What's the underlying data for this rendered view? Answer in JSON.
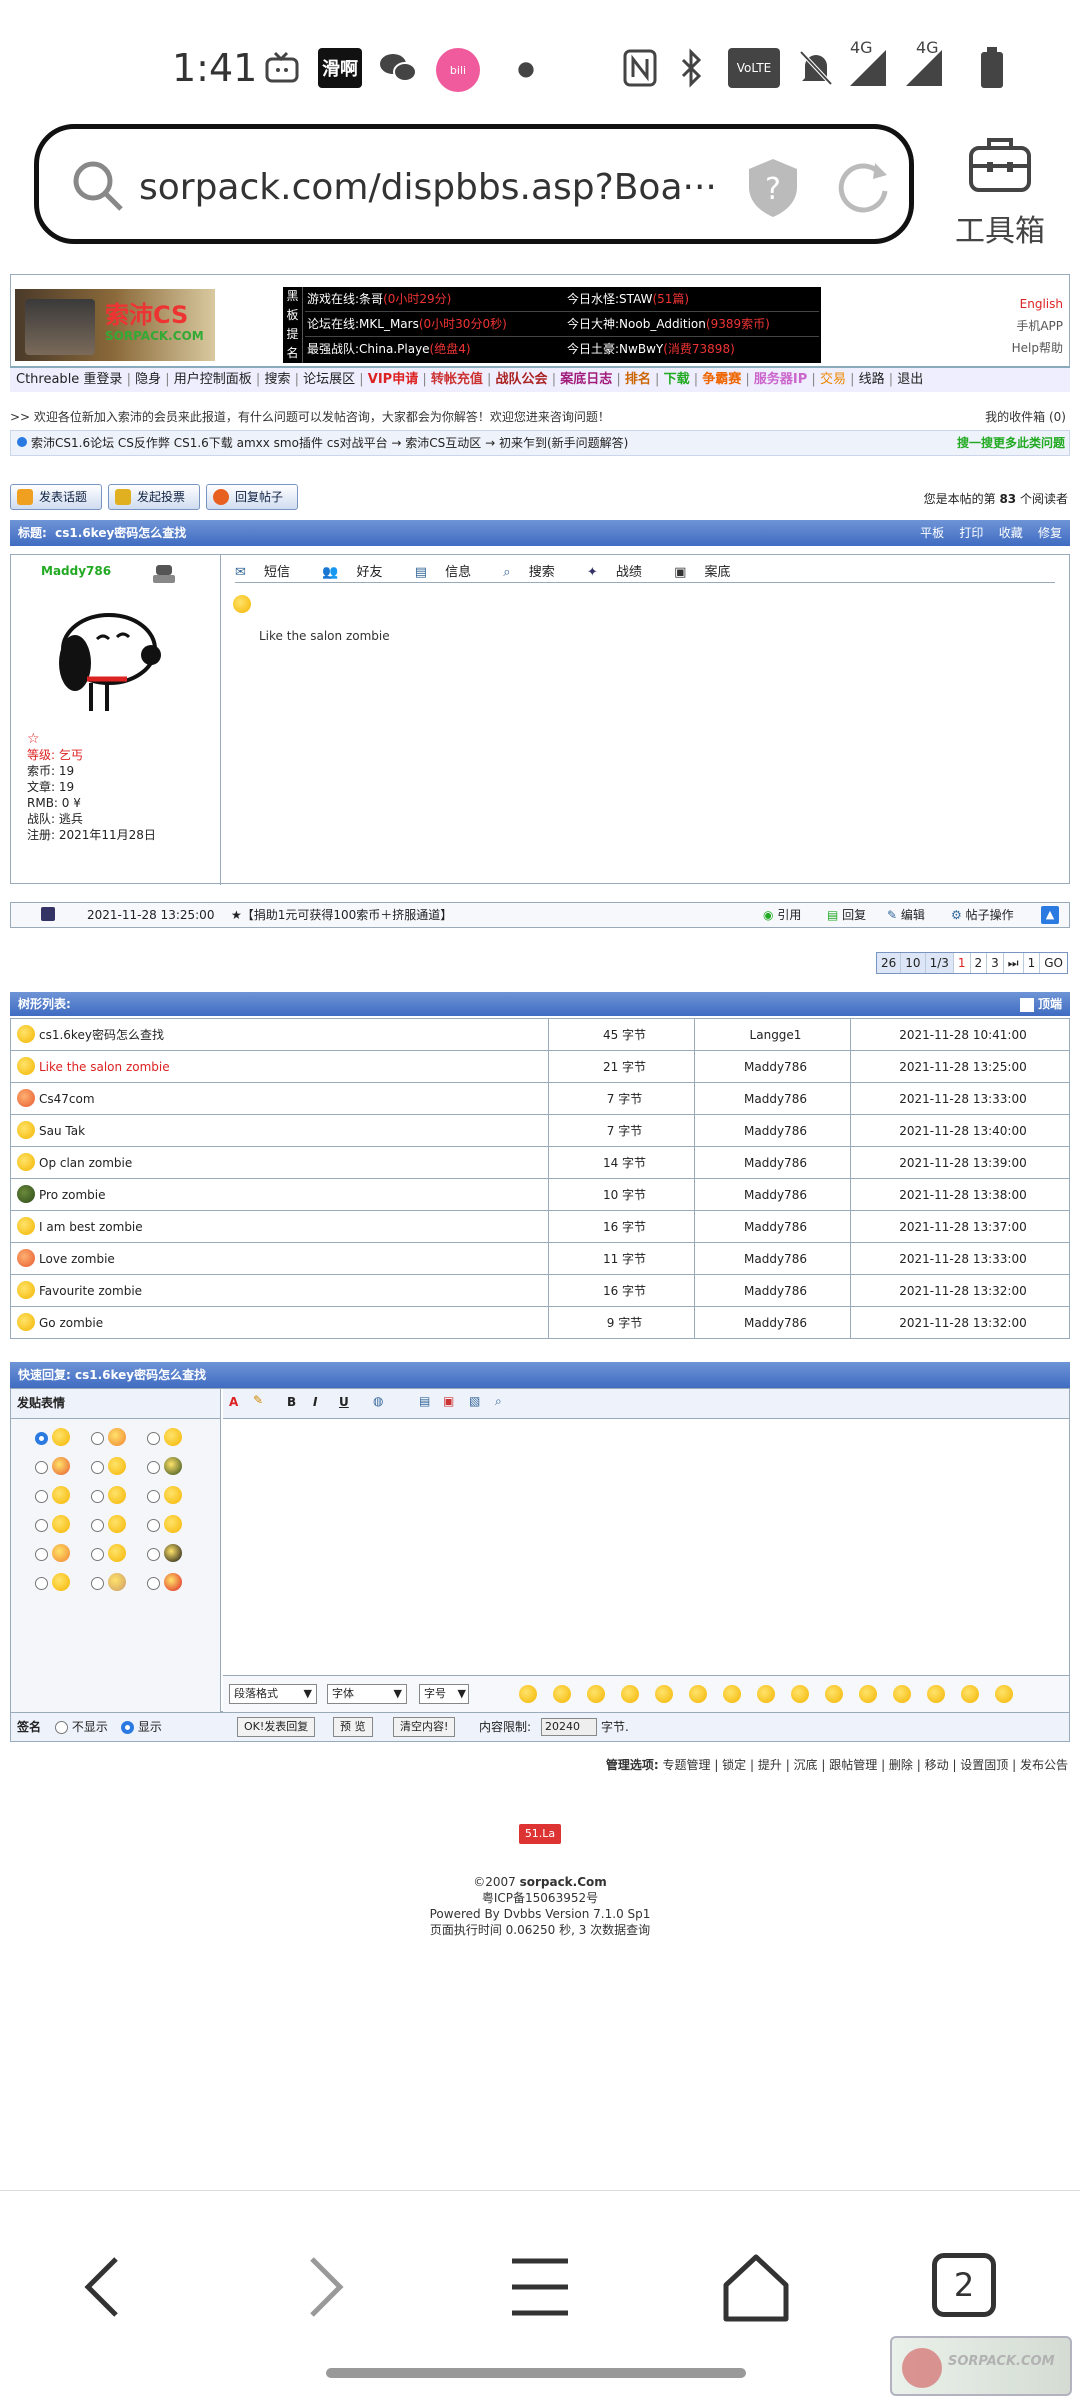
{
  "status_bar": {
    "time": "1:41",
    "notif_label": "滑啊",
    "signal1": "4G",
    "signal2": "4G"
  },
  "browser": {
    "url": "sorpack.com/dispbbs.asp?Boa···",
    "toolbox_label": "工具箱",
    "tab_count": "2"
  },
  "header": {
    "logo_text": "索沛CS",
    "logo_sub": "SORPACK.COM",
    "board_side": [
      "黑",
      "板",
      "提",
      "名"
    ],
    "board_rows": [
      {
        "left": "游戏在线:",
        "left_val": "条哥",
        "left_red": "(0小时29分)",
        "right": "今日水怪:",
        "right_val": "STAW",
        "right_red": "(51篇)"
      },
      {
        "left": "论坛在线:",
        "left_val": "MKL_Mars",
        "left_red": "(0小时30分0秒)",
        "right": "今日大神:",
        "right_val": "Noob_Addition",
        "right_red": "(9389索币)"
      },
      {
        "left": "最强战队:",
        "left_val": "China.Playe",
        "left_red": "(绝盘4)",
        "right": "今日土豪:",
        "right_val": "NwBwY",
        "right_red": "(消费73898)"
      }
    ],
    "right_links": [
      "English",
      "手机APP",
      "Help帮助"
    ]
  },
  "menu": {
    "items": [
      "Cthreable 重登录",
      "隐身",
      "用户控制面板",
      "搜索",
      "论坛展区",
      "VIP申请",
      "转帐充值",
      "战队公会",
      "案底日志",
      "排名",
      "下载",
      "争霸赛",
      "服务器IP",
      "交易",
      "线路",
      "退出"
    ],
    "colors": [
      "#222",
      "#222",
      "#222",
      "#222",
      "#222",
      "#d22",
      "#c33",
      "#a22",
      "#a21c7a",
      "#c60",
      "#2a2",
      "#e60",
      "#c6c",
      "#e80",
      "#222",
      "#222"
    ]
  },
  "welcome": {
    "left": ">> 欢迎各位新加入索沛的会员来此报道，有什么问题可以发帖咨询，大家都会为你解答！欢迎您进来咨询问题！",
    "right": "我的收件箱 (0)",
    "crumb": "索沛CS1.6论坛 CS反作弊 CS1.6下载 amxx smo插件 cs对战平台 → 索沛CS互动区 → 初来乍到(新手问题解答)",
    "crumb_right": "搜一搜更多此类问题"
  },
  "actions": {
    "new_topic": "发表话题",
    "new_poll": "发起投票",
    "reply": "回复帖子",
    "reader_prefix": "您是本帖的第",
    "reader_count": "83",
    "reader_suffix": "个阅读者"
  },
  "thread_bar": {
    "title_label": "标题:",
    "title": "cs1.6key密码怎么查找",
    "links": [
      "平板",
      "打印",
      "收藏",
      "修复"
    ]
  },
  "post": {
    "username": "Maddy786",
    "info": [
      "等级: 乞丐",
      "索币: 19",
      "文章: 19",
      "RMB: 0 ¥",
      "战队: 逃兵",
      "注册: 2021年11月28日"
    ],
    "tools": [
      "短信",
      "好友",
      "信息",
      "搜索",
      "战绩",
      "案底"
    ],
    "content": "Like the salon zombie",
    "time": "2021-11-28 13:25:00",
    "footer_note": "★【捐助1元可获得100索币＋挤服通道】",
    "actions": [
      "引用",
      "回复",
      "编辑",
      "帖子操作"
    ]
  },
  "pager": [
    "26",
    "10",
    "1/3",
    "1",
    "2",
    "3",
    "⏭",
    "1",
    "GO"
  ],
  "tree": {
    "title": "树形列表:",
    "top_label": "顶端",
    "rows": [
      {
        "title": "cs1.6key密码怎么查找",
        "size": "45 字节",
        "author": "Langge1",
        "time": "2021-11-28 10:41:00",
        "current": false
      },
      {
        "title": "Like the salon zombie",
        "size": "21 字节",
        "author": "Maddy786",
        "time": "2021-11-28 13:25:00",
        "current": true
      },
      {
        "title": "Cs47com",
        "size": "7 字节",
        "author": "Maddy786",
        "time": "2021-11-28 13:33:00",
        "current": false
      },
      {
        "title": "Sau Tak",
        "size": "7 字节",
        "author": "Maddy786",
        "time": "2021-11-28 13:40:00",
        "current": false
      },
      {
        "title": "Op clan zombie",
        "size": "14 字节",
        "author": "Maddy786",
        "time": "2021-11-28 13:39:00",
        "current": false
      },
      {
        "title": "Pro zombie",
        "size": "10 字节",
        "author": "Maddy786",
        "time": "2021-11-28 13:38:00",
        "current": false
      },
      {
        "title": "I am best zombie",
        "size": "16 字节",
        "author": "Maddy786",
        "time": "2021-11-28 13:37:00",
        "current": false
      },
      {
        "title": "Love zombie",
        "size": "11 字节",
        "author": "Maddy786",
        "time": "2021-11-28 13:33:00",
        "current": false
      },
      {
        "title": "Favourite zombie",
        "size": "16 字节",
        "author": "Maddy786",
        "time": "2021-11-28 13:32:00",
        "current": false
      },
      {
        "title": "Go zombie",
        "size": "9 字节",
        "author": "Maddy786",
        "time": "2021-11-28 13:32:00",
        "current": false
      }
    ]
  },
  "quick_reply": {
    "title": "快速回复: cs1.6key密码怎么查找",
    "face_label": "发贴表情",
    "tool_labels": [
      "B",
      "I",
      "U"
    ],
    "selects": [
      "段落格式",
      "字体",
      "字号"
    ],
    "sign_label": "签名",
    "hide_label": "不显示",
    "show_label": "显示",
    "submit": "OK!发表回复",
    "preview": "预 览",
    "clear": "清空内容!",
    "limit_label": "内容限制:",
    "limit_value": "20240",
    "limit_unit": "字节."
  },
  "manage": {
    "label": "管理选项:",
    "items": [
      "专题管理",
      "锁定",
      "提升",
      "沉底",
      "跟帖管理",
      "删除",
      "移动",
      "设置固顶",
      "发布公告"
    ]
  },
  "footer": {
    "badge": "51.La",
    "copyright": "©2007",
    "site": "sorpack.Com",
    "icp": "粤ICP备15063952号",
    "powered": "Powered By Dvbbs Version 7.1.0 Sp1",
    "exec": "页面执行时间 0.06250 秒, 3 次数据查询"
  },
  "watermark": "SORPACK.COM"
}
